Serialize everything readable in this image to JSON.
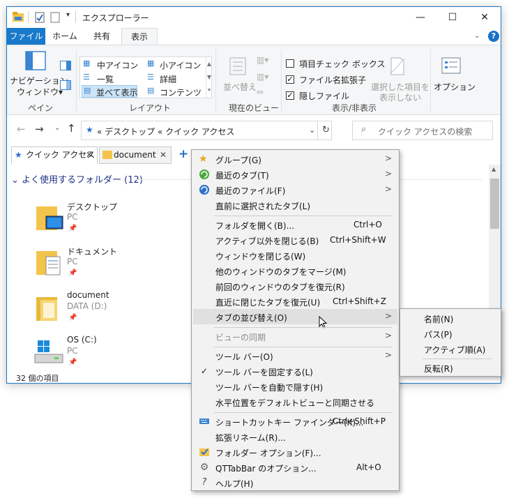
{
  "window": {
    "title": "エクスプローラー",
    "min_symbol": "—",
    "max_symbol": "☐",
    "close_symbol": "✕"
  },
  "ribbon_tabs": [
    "ファイル",
    "ホーム",
    "共有",
    "表示"
  ],
  "ribbon": {
    "nav_pane_label_1": "ナビゲーション",
    "nav_pane_label_2": "ウィンドウ▾",
    "pane_group": "ペイン",
    "layout_items": [
      "中アイコン",
      "小アイコン",
      "一覧",
      "詳細",
      "並べて表示",
      "コンテンツ"
    ],
    "layout_group": "レイアウト",
    "sort_label": "並べ替え",
    "current_view_group": "現在のビュー",
    "checkboxes": [
      {
        "label": "項目チェック ボックス",
        "checked": false
      },
      {
        "label": "ファイル名拡張子",
        "checked": true
      },
      {
        "label": "隠しファイル",
        "checked": true
      }
    ],
    "hide_selected_1": "選択した項目を",
    "hide_selected_2": "表示しない",
    "show_hide_group": "表示/非表示",
    "options_label": "オプション"
  },
  "address": {
    "path": "« デスクトップ « クイック アクセス",
    "search_placeholder": "クイック アクセスの検索"
  },
  "qt_tabs": [
    {
      "label": "クイック アクセス"
    },
    {
      "label": "document"
    }
  ],
  "add_tab": "+",
  "group_header": "よく使用するフォルダー (12)",
  "items": [
    {
      "name": "デスクトップ",
      "sub": "PC"
    },
    {
      "name": "ドキュメント",
      "sub": "PC"
    },
    {
      "name": "document",
      "sub": "DATA (D:)"
    },
    {
      "name": "OS (C:)",
      "sub": "PC"
    }
  ],
  "status_text": "32 個の項目",
  "context_menu": {
    "items": [
      {
        "label": "グループ(G)",
        "submenu": true
      },
      {
        "label": "最近のタブ(T)",
        "submenu": true
      },
      {
        "label": "最近のファイル(F)",
        "submenu": true
      },
      {
        "label": "直前に選択されたタブ(L)"
      },
      {
        "label": "フォルダを開く(B)...",
        "shortcut": "Ctrl+O"
      },
      {
        "label": "アクティブ以外を閉じる(B)",
        "shortcut": "Ctrl+Shift+W"
      },
      {
        "label": "ウィンドウを閉じる(W)"
      },
      {
        "label": "他のウィンドウのタブをマージ(M)"
      },
      {
        "label": "前回のウィンドウのタブを復元(R)"
      },
      {
        "label": "直近に閉じたタブを復元(U)",
        "shortcut": "Ctrl+Shift+Z"
      },
      {
        "label": "タブの並び替え(O)",
        "submenu": true,
        "highlight": true
      },
      {
        "label": "ビューの同期",
        "submenu": true,
        "disabled": true
      },
      {
        "label": "ツール バー(O)",
        "submenu": true
      },
      {
        "label": "ツール バーを固定する(L)",
        "checked": true
      },
      {
        "label": "ツール バーを自動で隠す(H)"
      },
      {
        "label": "水平位置をデフォルトビューと同期させる"
      },
      {
        "label": "ショートカットキー ファインダー(K)...",
        "shortcut": "Ctrl+Shift+P"
      },
      {
        "label": "拡張リネーム(R)..."
      },
      {
        "label": "フォルダー オプション(F)..."
      },
      {
        "label": "QTTabBar のオプション...",
        "shortcut": "Alt+O"
      },
      {
        "label": "ヘルプ(H)"
      }
    ]
  },
  "submenu": {
    "items": [
      "名前(N)",
      "パス(P)",
      "アクティブ順(A)",
      "反転(R)"
    ]
  }
}
